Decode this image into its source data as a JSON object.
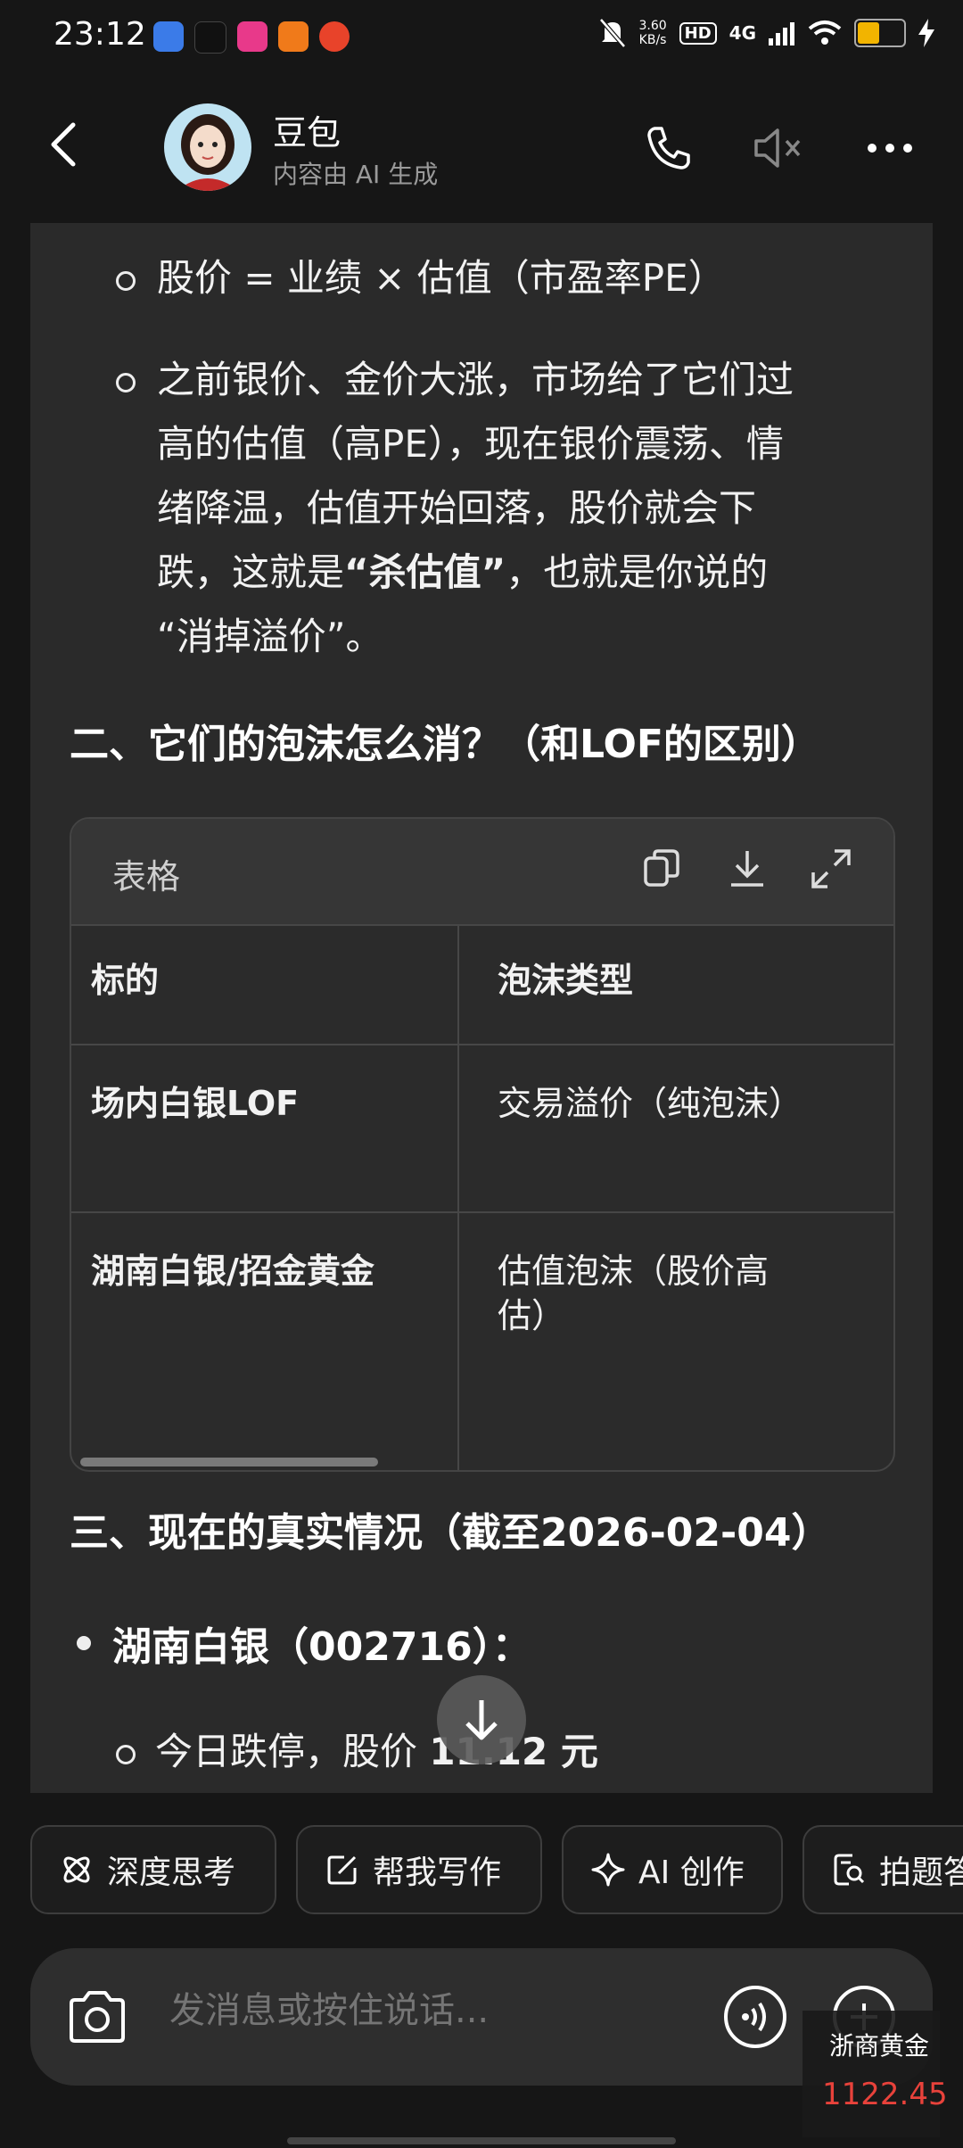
{
  "status_bar": {
    "time": "23:12",
    "net_speed_value": "3.60",
    "net_speed_unit": "KB/s",
    "hd": "HD",
    "network": "4G",
    "battery_level": 0.45
  },
  "header": {
    "bot_name": "豆包",
    "subtitle": "内容由 AI 生成"
  },
  "chat": {
    "item1": "股价 = 业绩 × 估值（市盈率PE）",
    "item2": {
      "line1": "之前银价、金价大涨，市场给了它们过",
      "line2": "高的估值（高PE），现在银价震荡、情",
      "line3": "绪降温，估值开始回落，股价就会下",
      "line4_pre": "跌，这就是",
      "line4_bold": "“杀估值”",
      "line4_post": "，也就是你说的",
      "line5": "“消掉溢价”。"
    },
    "section2": "二、它们的泡沫怎么消？（和LOF的区别）",
    "table": {
      "title": "表格",
      "headers": [
        "标的",
        "泡沫类型"
      ],
      "rows": [
        [
          "场内白银LOF",
          "交易溢价（纯泡沫）"
        ],
        [
          "湖南白银/招金黄金",
          "估值泡沫（股价高估）"
        ]
      ],
      "row2_col2_line1": "估值泡沫（股价高",
      "row2_col2_line2": "估）"
    },
    "section3": "三、现在的真实情况（截至2026-02-04）",
    "bullet1": "湖南白银（002716）：",
    "sub_bullet_pre": "今日跌停，股价 ",
    "sub_bullet_hidden": "11",
    "sub_bullet_post": ".12 元"
  },
  "chips": [
    {
      "label": "深度思考",
      "icon": "atom-icon"
    },
    {
      "label": "帮我写作",
      "icon": "edit-icon"
    },
    {
      "label": "AI 创作",
      "icon": "sparkle-icon"
    },
    {
      "label": "拍题答",
      "icon": "photo-question-icon"
    }
  ],
  "composer": {
    "placeholder": "发消息或按住说话..."
  },
  "widget": {
    "name": "浙商黄金",
    "price": "1122.45"
  }
}
